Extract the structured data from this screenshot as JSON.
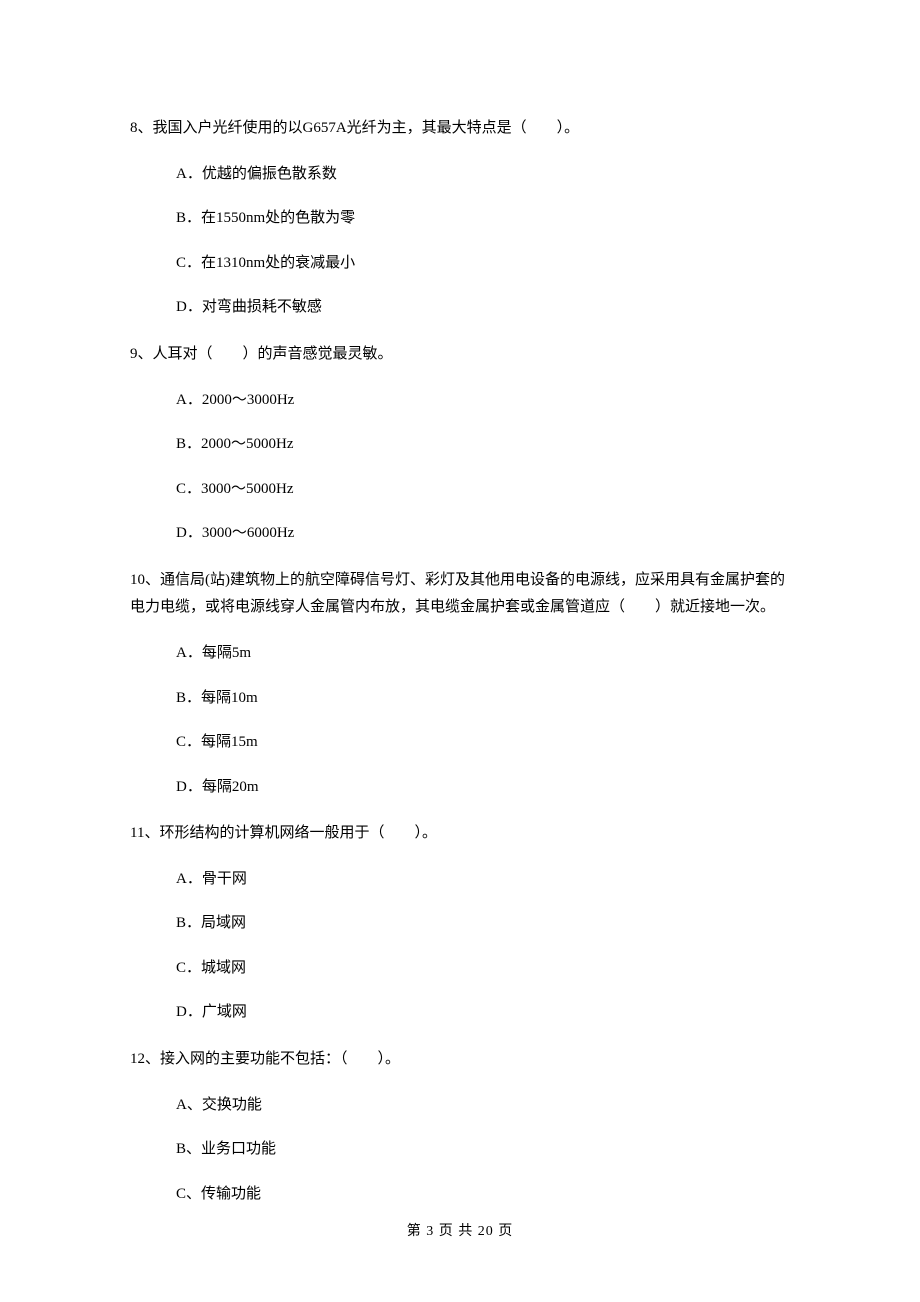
{
  "questions": [
    {
      "num": "8、",
      "text": "我国入户光纤使用的以G657A光纤为主，其最大特点是（　　）。",
      "opts": [
        "A．优越的偏振色散系数",
        "B．在1550nm处的色散为零",
        "C．在1310nm处的衰减最小",
        "D．对弯曲损耗不敏感"
      ]
    },
    {
      "num": "9、",
      "text": "人耳对（　　）的声音感觉最灵敏。",
      "opts": [
        "A．2000～3000Hz",
        "B．2000～5000Hz",
        "C．3000～5000Hz",
        "D．3000～6000Hz"
      ]
    },
    {
      "num": "10、",
      "text": "通信局(站)建筑物上的航空障碍信号灯、彩灯及其他用电设备的电源线，应采用具有金属护套的电力电缆，或将电源线穿人金属管内布放，其电缆金属护套或金属管道应（　　）就近接地一次。",
      "opts": [
        "A．每隔5m",
        "B．每隔10m",
        "C．每隔15m",
        "D．每隔20m"
      ]
    },
    {
      "num": "11、",
      "text": "环形结构的计算机网络一般用于（　　）。",
      "opts": [
        "A．骨干网",
        "B．局域网",
        "C．城域网",
        "D．广域网"
      ]
    },
    {
      "num": "12、",
      "text": "接入网的主要功能不包括：（　　）。",
      "opts": [
        "A、交换功能",
        "B、业务口功能",
        "C、传输功能"
      ]
    }
  ],
  "footer": "第 3 页 共 20 页"
}
